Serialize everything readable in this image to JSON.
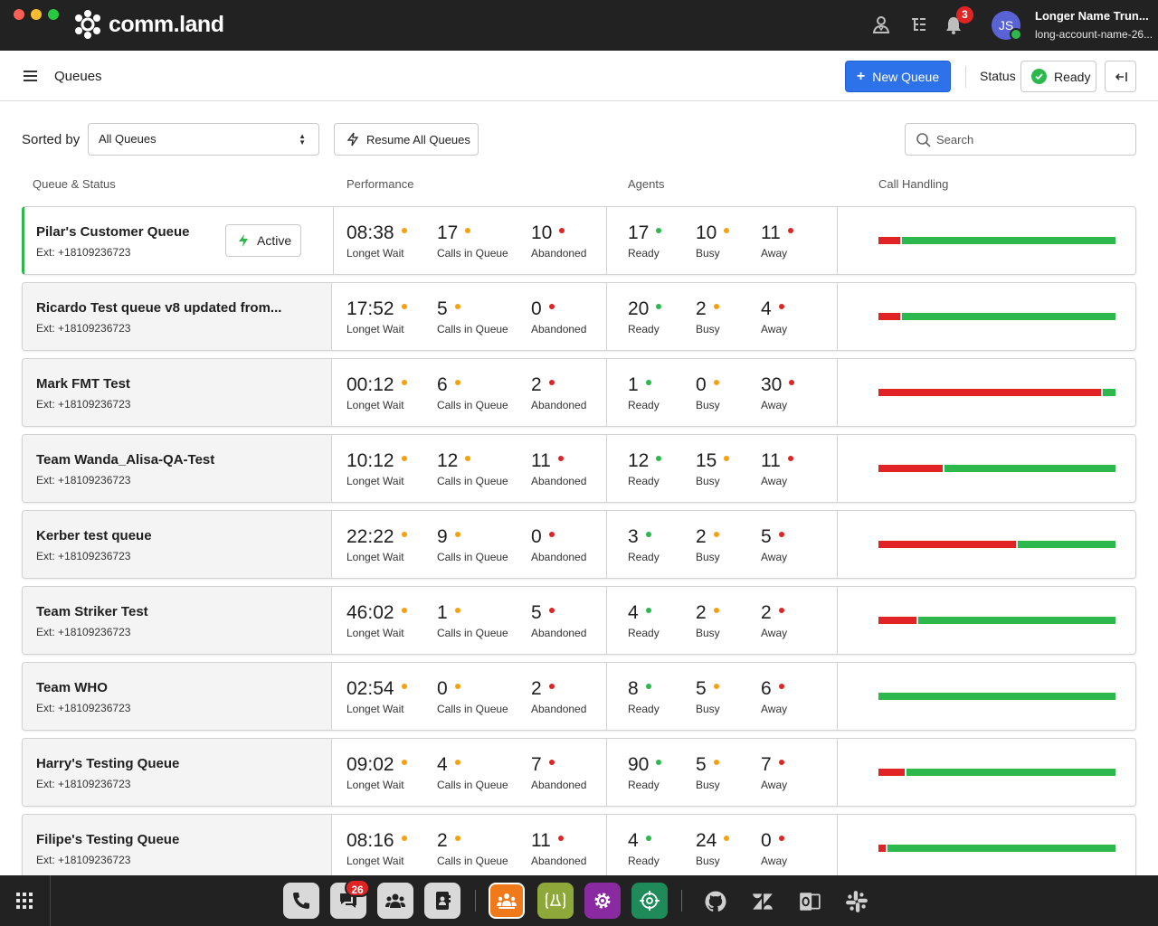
{
  "app": {
    "brand": "comm.land",
    "notification_count": "3",
    "user": {
      "initials": "JS",
      "name": "Longer Name Trun...",
      "account": "long-account-name-26..."
    }
  },
  "header": {
    "title": "Queues",
    "new_queue_label": "New Queue",
    "status_label": "Status",
    "status_value": "Ready"
  },
  "toolbar": {
    "sorted_by_label": "Sorted by",
    "sort_selected": "All Queues",
    "resume_label": "Resume All Queues",
    "search_placeholder": "Search"
  },
  "columns": {
    "queue_status": "Queue & Status",
    "performance": "Performance",
    "agents": "Agents",
    "call_handling": "Call Handling"
  },
  "labels": {
    "wait": "Longet Wait",
    "calls": "Calls in Queue",
    "abandoned": "Abandoned",
    "ready": "Ready",
    "busy": "Busy",
    "away": "Away",
    "active": "Active"
  },
  "colors": {
    "accent": "#2d72e8",
    "green": "#2cb84c",
    "orange": "#f5a00f",
    "red": "#e02424"
  },
  "queues": [
    {
      "name": "Pilar's Customer Queue",
      "ext": "Ext: +18109236723",
      "active": true,
      "wait": "08:38",
      "calls": "17",
      "abandoned": "10",
      "ready": "17",
      "busy": "10",
      "away": "11",
      "failed_fraction": 0.09
    },
    {
      "name": "Ricardo Test queue v8 updated from...",
      "ext": "Ext: +18109236723",
      "active": false,
      "wait": "17:52",
      "calls": "5",
      "abandoned": "0",
      "ready": "20",
      "busy": "2",
      "away": "4",
      "failed_fraction": 0.09
    },
    {
      "name": "Mark FMT Test",
      "ext": "Ext: +18109236723",
      "active": false,
      "wait": "00:12",
      "calls": "6",
      "abandoned": "2",
      "ready": "1",
      "busy": "0",
      "away": "30",
      "failed_fraction": 0.94
    },
    {
      "name": "Team Wanda_Alisa-QA-Test",
      "ext": "Ext: +18109236723",
      "active": false,
      "wait": "10:12",
      "calls": "12",
      "abandoned": "11",
      "ready": "12",
      "busy": "15",
      "away": "11",
      "failed_fraction": 0.27
    },
    {
      "name": "Kerber test queue",
      "ext": "Ext: +18109236723",
      "active": false,
      "wait": "22:22",
      "calls": "9",
      "abandoned": "0",
      "ready": "3",
      "busy": "2",
      "away": "5",
      "failed_fraction": 0.58
    },
    {
      "name": "Team Striker Test",
      "ext": "Ext: +18109236723",
      "active": false,
      "wait": "46:02",
      "calls": "1",
      "abandoned": "5",
      "ready": "4",
      "busy": "2",
      "away": "2",
      "failed_fraction": 0.16
    },
    {
      "name": "Team WHO",
      "ext": "Ext: +18109236723",
      "active": false,
      "wait": "02:54",
      "calls": "0",
      "abandoned": "2",
      "ready": "8",
      "busy": "5",
      "away": "6",
      "failed_fraction": 0
    },
    {
      "name": "Harry's Testing Queue",
      "ext": "Ext: +18109236723",
      "active": false,
      "wait": "09:02",
      "calls": "4",
      "abandoned": "7",
      "ready": "90",
      "busy": "5",
      "away": "7",
      "failed_fraction": 0.11
    },
    {
      "name": "Filipe's Testing Queue",
      "ext": "Ext: +18109236723",
      "active": false,
      "wait": "08:16",
      "calls": "2",
      "abandoned": "11",
      "ready": "4",
      "busy": "24",
      "away": "0",
      "failed_fraction": 0.03
    }
  ],
  "dock": {
    "messages_badge": "26",
    "apps": [
      {
        "icon": "phone-icon",
        "color": "#d9d9d9"
      },
      {
        "icon": "messages-icon",
        "color": "#d9d9d9"
      },
      {
        "icon": "team-icon",
        "color": "#d9d9d9"
      },
      {
        "icon": "contacts-icon",
        "color": "#d9d9d9"
      },
      {
        "icon": "queues-icon",
        "color": "#f07a1a"
      },
      {
        "icon": "lab-icon",
        "color": "#8fa83a"
      },
      {
        "icon": "settings-icon",
        "color": "#8a2aa0"
      },
      {
        "icon": "target-icon",
        "color": "#1f8a5a"
      }
    ],
    "integrations": [
      "github-icon",
      "zendesk-icon",
      "outlook-icon",
      "slack-icon"
    ]
  }
}
